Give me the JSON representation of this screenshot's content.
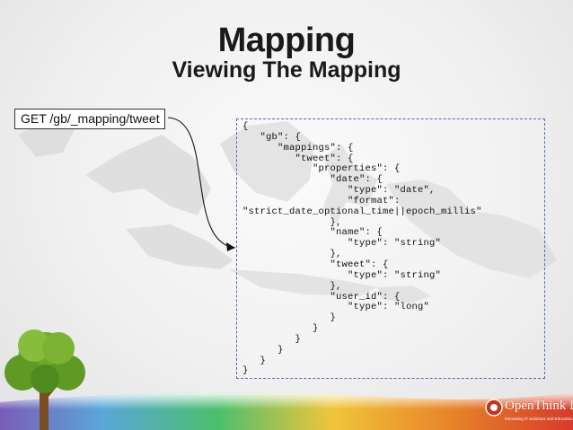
{
  "slide": {
    "title": "Mapping",
    "subtitle": "Viewing The Mapping"
  },
  "request": {
    "label": "GET /gb/_mapping/tweet"
  },
  "response": {
    "json_text": "{\n   \"gb\": {\n      \"mappings\": {\n         \"tweet\": {\n            \"properties\": {\n               \"date\": {\n                  \"type\": \"date\",\n                  \"format\":\n\"strict_date_optional_time||epoch_millis\"\n               },\n               \"name\": {\n                  \"type\": \"string\"\n               },\n               \"tweet\": {\n                  \"type\": \"string\"\n               },\n               \"user_id\": {\n                  \"type\": \"long\"\n               }\n            }\n         }\n      }\n   }\n}"
  },
  "branding": {
    "name": "OpenThink Labs",
    "tagline": "Innovating IT Solutions and Education",
    "logo_icon": "logo-icon",
    "tree_icon": "tree-icon",
    "rainbow_colors": [
      "#7a5cb8",
      "#5aa7d8",
      "#4cbf6e",
      "#f0c53a",
      "#e8862a",
      "#d73a2a"
    ]
  }
}
